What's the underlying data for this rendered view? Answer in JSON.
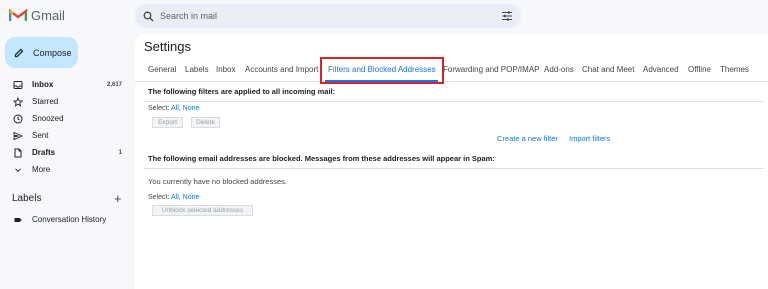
{
  "app": {
    "name": "Gmail"
  },
  "search": {
    "placeholder": "Search in mail"
  },
  "compose": {
    "label": "Compose"
  },
  "nav": {
    "items": [
      {
        "label": "Inbox",
        "count": "2,617"
      },
      {
        "label": "Starred",
        "count": ""
      },
      {
        "label": "Snoozed",
        "count": ""
      },
      {
        "label": "Sent",
        "count": ""
      },
      {
        "label": "Drafts",
        "count": "1"
      },
      {
        "label": "More",
        "count": ""
      }
    ]
  },
  "labels": {
    "heading": "Labels",
    "add": "+",
    "items": [
      {
        "label": "Conversation History"
      }
    ]
  },
  "settings": {
    "title": "Settings",
    "tabs": [
      {
        "label": "General"
      },
      {
        "label": "Labels"
      },
      {
        "label": "Inbox"
      },
      {
        "label": "Accounts and Import"
      },
      {
        "label": "Filters and Blocked Addresses"
      },
      {
        "label": "Forwarding and POP/IMAP"
      },
      {
        "label": "Add-ons"
      },
      {
        "label": "Chat and Meet"
      },
      {
        "label": "Advanced"
      },
      {
        "label": "Offline"
      },
      {
        "label": "Themes"
      }
    ],
    "filters_heading": "The following filters are applied to all incoming mail:",
    "select_prefix": "Select:",
    "select_all": "All",
    "select_sep": ",",
    "select_none": "None",
    "export_label": "Export",
    "delete_label": "Delete",
    "create_filter": "Create a new filter",
    "import_filters": "Import filters",
    "blocked_heading": "The following email addresses are blocked. Messages from these addresses will appear in Spam:",
    "no_blocked": "You currently have no blocked addresses.",
    "unblock_label": "Unblock selected addresses"
  },
  "colors": {
    "accent": "#1a73e8",
    "highlight": "#d0262b",
    "compose_bg": "#c2e7ff"
  }
}
